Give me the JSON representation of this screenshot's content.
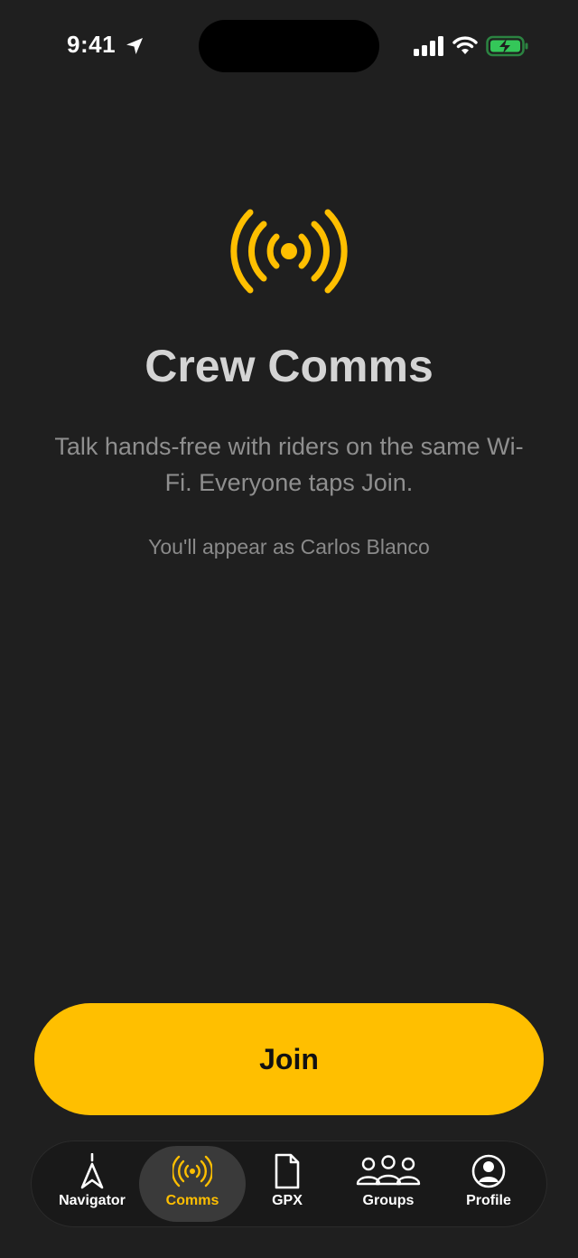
{
  "status_bar": {
    "time": "9:41"
  },
  "hero": {
    "title": "Crew Comms",
    "subtitle": "Talk hands-free with riders on the same Wi-Fi. Everyone taps Join.",
    "appear_as": "You'll appear as Carlos Blanco"
  },
  "actions": {
    "join_label": "Join"
  },
  "tab_bar": {
    "items": [
      {
        "label": "Navigator",
        "icon": "navigator-icon"
      },
      {
        "label": "Comms",
        "icon": "broadcast-icon"
      },
      {
        "label": "GPX",
        "icon": "document-icon"
      },
      {
        "label": "Groups",
        "icon": "groups-icon"
      },
      {
        "label": "Profile",
        "icon": "profile-icon"
      }
    ],
    "active_index": 1
  },
  "colors": {
    "background": "#1f1f1f",
    "accent": "#ffbf00",
    "battery_charging": "#34c759"
  }
}
